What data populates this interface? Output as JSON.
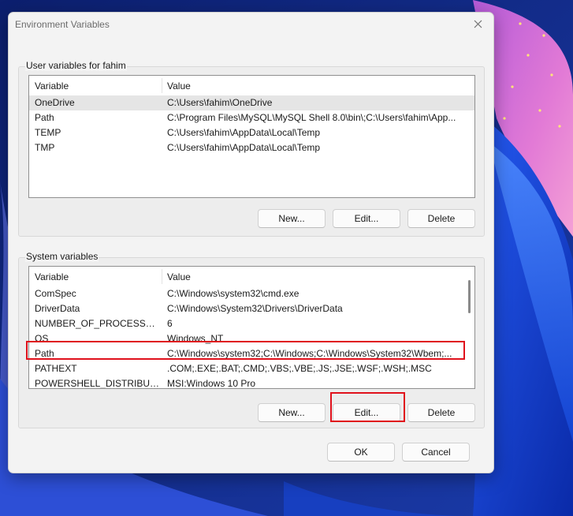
{
  "window": {
    "title": "Environment Variables"
  },
  "user_variables": {
    "group_label": "User variables for fahim",
    "columns": [
      "Variable",
      "Value"
    ],
    "rows": [
      {
        "name": "OneDrive",
        "value": "C:\\Users\\fahim\\OneDrive"
      },
      {
        "name": "Path",
        "value": "C:\\Program Files\\MySQL\\MySQL Shell 8.0\\bin\\;C:\\Users\\fahim\\App..."
      },
      {
        "name": "TEMP",
        "value": "C:\\Users\\fahim\\AppData\\Local\\Temp"
      },
      {
        "name": "TMP",
        "value": "C:\\Users\\fahim\\AppData\\Local\\Temp"
      }
    ],
    "buttons": {
      "new": "New...",
      "edit": "Edit...",
      "delete": "Delete"
    }
  },
  "system_variables": {
    "group_label": "System variables",
    "columns": [
      "Variable",
      "Value"
    ],
    "rows": [
      {
        "name": "ComSpec",
        "value": "C:\\Windows\\system32\\cmd.exe"
      },
      {
        "name": "DriverData",
        "value": "C:\\Windows\\System32\\Drivers\\DriverData"
      },
      {
        "name": "NUMBER_OF_PROCESSORS",
        "value": "6"
      },
      {
        "name": "OS",
        "value": "Windows_NT"
      },
      {
        "name": "Path",
        "value": "C:\\Windows\\system32;C:\\Windows;C:\\Windows\\System32\\Wbem;..."
      },
      {
        "name": "PATHEXT",
        "value": ".COM;.EXE;.BAT;.CMD;.VBS;.VBE;.JS;.JSE;.WSF;.WSH;.MSC"
      },
      {
        "name": "POWERSHELL_DISTRIBUTIO...",
        "value": "MSI:Windows 10 Pro"
      }
    ],
    "buttons": {
      "new": "New...",
      "edit": "Edit...",
      "delete": "Delete"
    }
  },
  "footer": {
    "ok": "OK",
    "cancel": "Cancel"
  },
  "colors": {
    "highlight": "#e0121c",
    "dialog_bg": "#f3f3f3"
  },
  "icons": {
    "close": "close-icon"
  }
}
